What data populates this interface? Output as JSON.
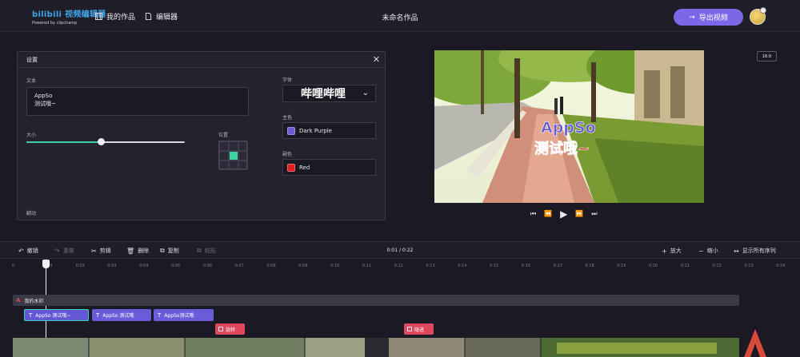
{
  "header": {
    "logo_main": "bilibili 视频编辑器",
    "logo_sub": "Powered by clipchamp",
    "nav_works": "我的作品",
    "nav_editor": "编辑器",
    "doc_title": "未命名作品",
    "export_label": "导出视频"
  },
  "settings": {
    "title": "设置",
    "text_label": "文本",
    "text_value": "AppSo\n测试哦~",
    "size_label": "大小",
    "size_fraction": 0.47,
    "position_label": "位置",
    "position_selected": "center",
    "font_label": "字体",
    "font_value": "哔哩哔哩",
    "primary_label": "主色",
    "primary_value": "Dark Purple",
    "primary_color": "#6b5bd2",
    "secondary_label": "副色",
    "secondary_value": "Red",
    "secondary_color": "#e02020",
    "bottom_label": "翻动"
  },
  "preview": {
    "aspect": "16:9",
    "overlay_line1": "AppSo",
    "overlay_line2": "测试哦~"
  },
  "toolbar": {
    "undo": "撤销",
    "redo": "重做",
    "cut": "剪辑",
    "delete": "删除",
    "duplicate": "复制",
    "paste": "粘贴",
    "timecode": "0:01 / 0:22",
    "zoom_in": "放大",
    "zoom_out": "缩小",
    "show_all": "显示所有序列"
  },
  "timeline": {
    "ticks": [
      "0",
      "0:01",
      "0:02",
      "0:03",
      "0:04",
      "0:05",
      "0:06",
      "0:07",
      "0:08",
      "0:09",
      "0:10",
      "0:11",
      "0:12",
      "0:13",
      "0:14",
      "0:15",
      "0:16",
      "0:17",
      "0:18",
      "0:19",
      "0:20",
      "0:21",
      "0:22",
      "0:23",
      "0:24"
    ],
    "watermark_label": "我的水印",
    "text_clips": [
      "AppSo 测试哦~",
      "AppSo 测试哦",
      "AppSo测试哦"
    ],
    "transitions": [
      "旋转",
      "隐进"
    ]
  },
  "colors": {
    "accent": "#7b68e8",
    "teal": "#3dd0a4",
    "transition": "#e0465c"
  }
}
